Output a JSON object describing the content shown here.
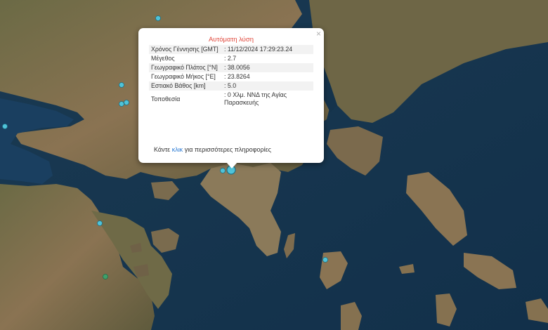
{
  "popup": {
    "title": "Αυτόματη λύση",
    "close_symbol": "×",
    "rows": [
      {
        "label": "Χρόνος Γέννησης [GMT]",
        "value": ": 11/12/2024 17:29:23.24"
      },
      {
        "label": "Μέγεθος",
        "value": ": 2.7"
      },
      {
        "label": "Γεωγραφικό Πλάτος [°N]",
        "value": ": 38.0056"
      },
      {
        "label": "Γεωγραφικό Μήκος [°E]",
        "value": ": 23.8264"
      },
      {
        "label": "Εστιακό Βάθος [km]",
        "value": ": 5.0"
      },
      {
        "label": "Τοποθεσία",
        "value": ": 0 Χλμ. ΝΝΔ της Αγίας Παρασκευής"
      }
    ],
    "more_prefix": "Κάντε",
    "more_link": "κλικ",
    "more_suffix": "για περισσότερες πληροφορίες"
  },
  "colors": {
    "sea": "#163650",
    "land": "#7a6a4c",
    "marker": "#4fc3d9",
    "popup_title": "#e0463a",
    "link": "#2a7ad4"
  }
}
